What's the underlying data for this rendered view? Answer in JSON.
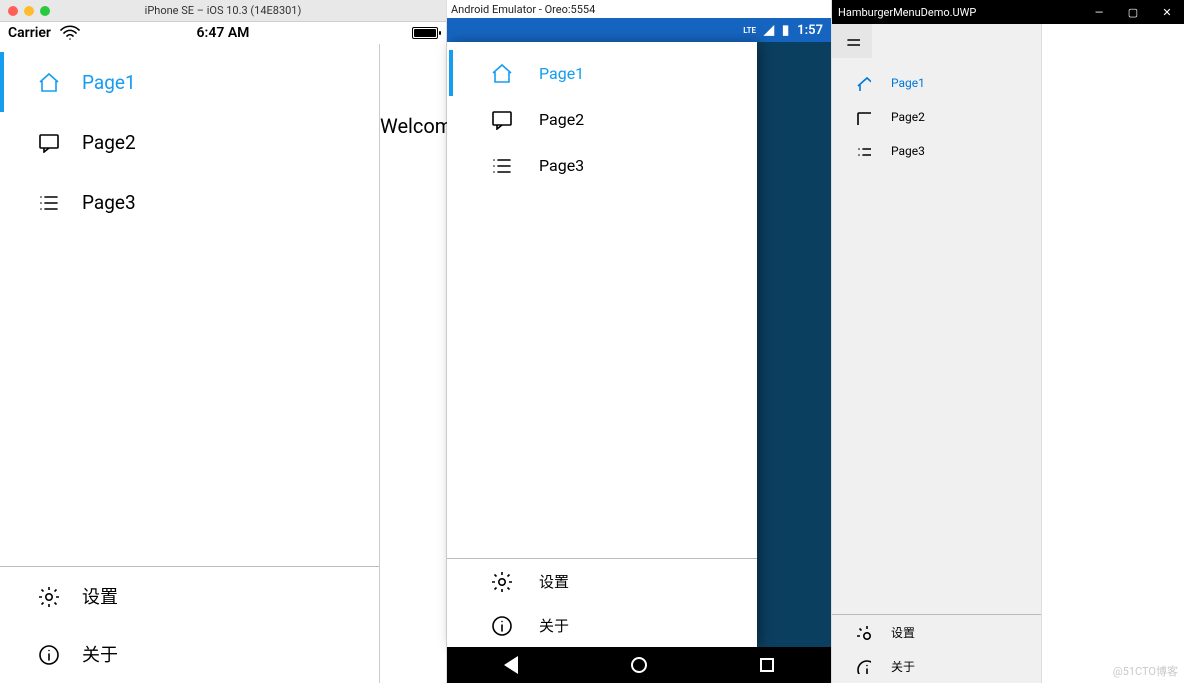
{
  "ios": {
    "window_title": "iPhone SE – iOS 10.3 (14E8301)",
    "status": {
      "carrier": "Carrier",
      "time": "6:47 AM"
    },
    "menu": [
      {
        "icon": "home-icon",
        "label": "Page1",
        "selected": true
      },
      {
        "icon": "chat-icon",
        "label": "Page2",
        "selected": false
      },
      {
        "icon": "list-icon",
        "label": "Page3",
        "selected": false
      }
    ],
    "options": [
      {
        "icon": "gear-icon",
        "label": "设置"
      },
      {
        "icon": "info-icon",
        "label": "关于"
      }
    ],
    "peek_text": "Welcome"
  },
  "android": {
    "window_title": "Android Emulator - Oreo:5554",
    "status": {
      "lte": "LTE",
      "time": "1:57"
    },
    "menu": [
      {
        "icon": "home-icon",
        "label": "Page1",
        "selected": true
      },
      {
        "icon": "chat-icon",
        "label": "Page2",
        "selected": false
      },
      {
        "icon": "list-icon",
        "label": "Page3",
        "selected": false
      }
    ],
    "options": [
      {
        "icon": "gear-icon",
        "label": "设置"
      },
      {
        "icon": "info-icon",
        "label": "关于"
      }
    ]
  },
  "uwp": {
    "window_title": "HamburgerMenuDemo.UWP",
    "menu": [
      {
        "icon": "home-icon",
        "label": "Page1",
        "selected": true
      },
      {
        "icon": "chat-icon",
        "label": "Page2",
        "selected": false
      },
      {
        "icon": "list-icon",
        "label": "Page3",
        "selected": false
      }
    ],
    "options": [
      {
        "icon": "gear-icon",
        "label": "设置"
      },
      {
        "icon": "info-icon",
        "label": "关于"
      }
    ]
  },
  "watermark": "@51CTO博客"
}
